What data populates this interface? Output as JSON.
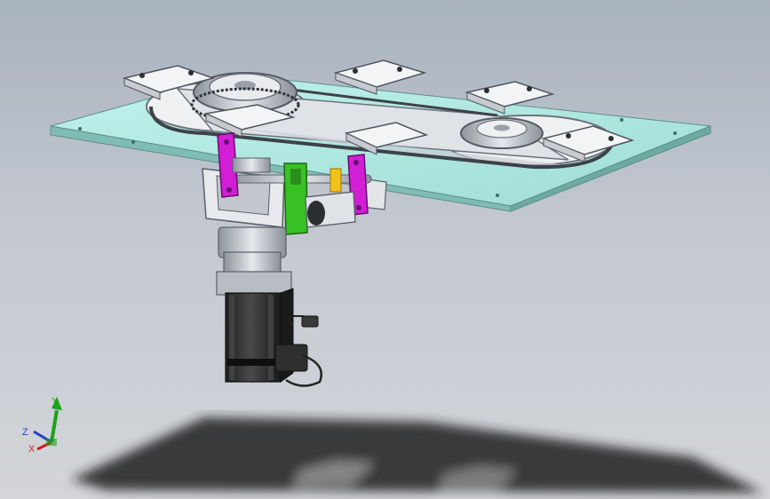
{
  "viewport": {
    "background_top": "#a9b2bf",
    "background_bottom": "#d3d5d9"
  },
  "model": {
    "plate_color": "#aee8e2",
    "carriage_color": "#e9ebee",
    "clamp_color": "#d21fd6",
    "bracket_color": "#39c025",
    "cylinder_accent": "#f2c21a",
    "motor_color": "#2c2c2c",
    "gear_color": "#d9dbe0",
    "shaft_color": "#c6c9cf"
  },
  "triad": {
    "y_label": "Y",
    "x_label": "X",
    "z_label": "Z",
    "y_color": "#1aa31a",
    "x_color": "#d11b1b",
    "z_color": "#2a3fbf"
  }
}
